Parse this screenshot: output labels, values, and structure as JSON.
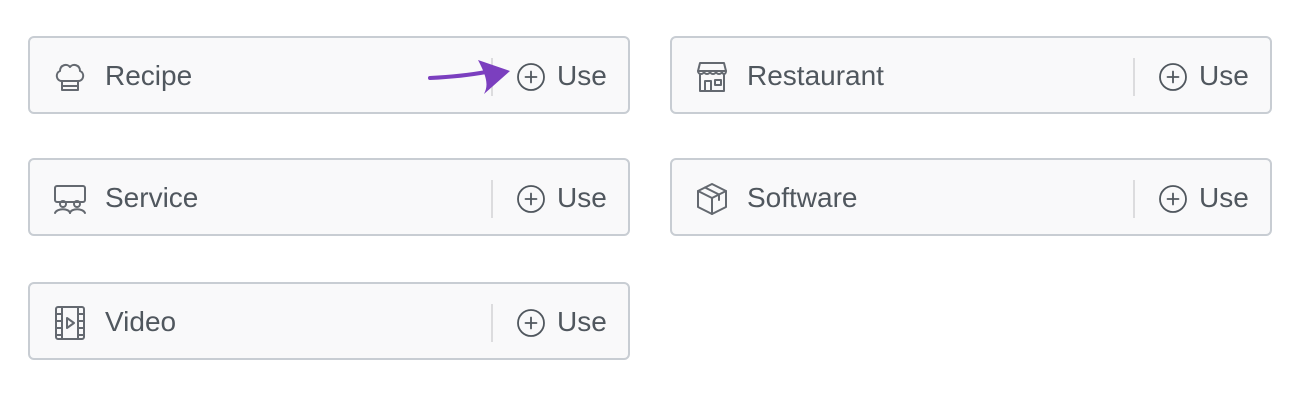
{
  "schema_types": [
    {
      "id": "recipe",
      "label": "Recipe",
      "icon": "chef-hat-icon",
      "action_label": "Use"
    },
    {
      "id": "restaurant",
      "label": "Restaurant",
      "icon": "storefront-icon",
      "action_label": "Use"
    },
    {
      "id": "service",
      "label": "Service",
      "icon": "service-icon",
      "action_label": "Use"
    },
    {
      "id": "software",
      "label": "Software",
      "icon": "package-box-icon",
      "action_label": "Use"
    },
    {
      "id": "video",
      "label": "Video",
      "icon": "video-film-icon",
      "action_label": "Use"
    }
  ],
  "annotation": {
    "icon": "pointer-arrow-icon",
    "color": "#7b3fbf"
  },
  "colors": {
    "card_border": "#c8cdd3",
    "card_background": "#f9f9fa",
    "text": "#50575e",
    "icon": "#646970"
  }
}
